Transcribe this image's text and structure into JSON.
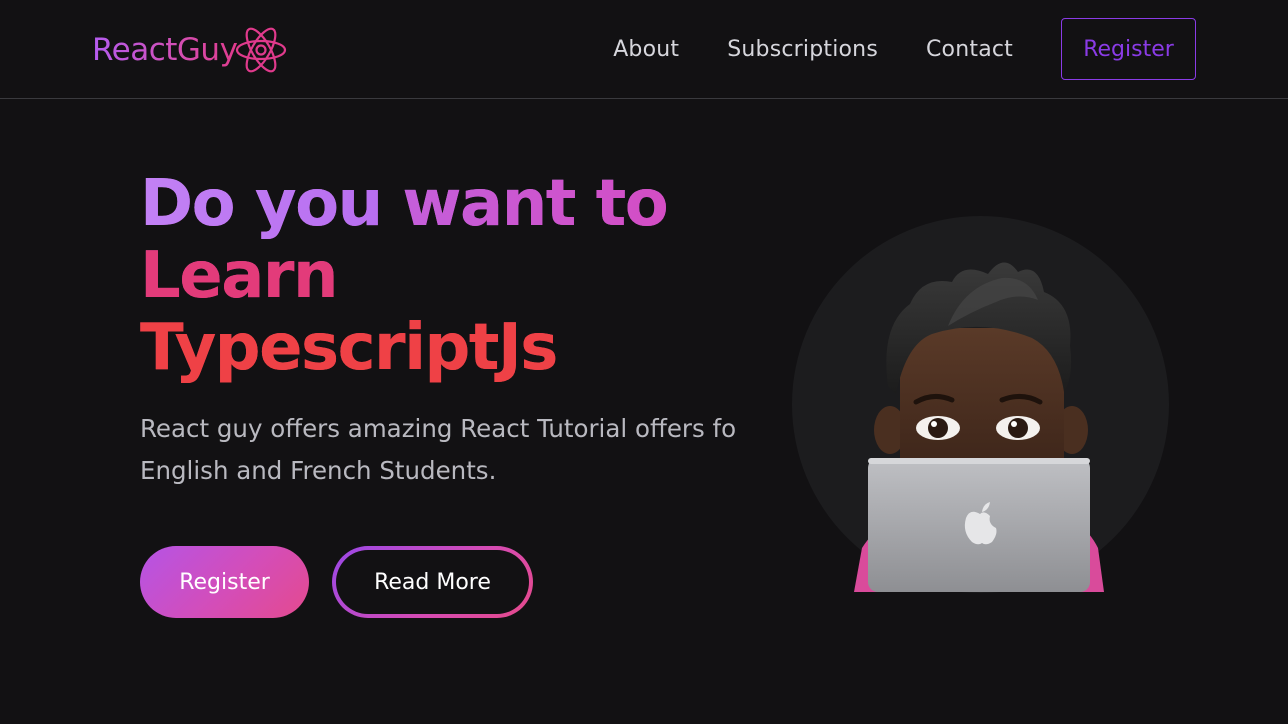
{
  "brand": {
    "name": "ReactGuy",
    "icon": "react-atom-icon",
    "colors": {
      "accent_purple": "#8a3be6",
      "gradient_start": "#b45cf0",
      "gradient_mid": "#d44fb4",
      "gradient_end": "#ef4146"
    }
  },
  "nav": {
    "links": [
      "About",
      "Subscriptions",
      "Contact"
    ],
    "register_label": "Register"
  },
  "hero": {
    "title": {
      "line1_word1": "Do you",
      "line1_word2": "want to",
      "line2": "Learn",
      "line3": "TypescriptJs"
    },
    "description_line1": "React guy offers amazing React Tutorial offers fo",
    "description_line2": "English and French Students.",
    "primary_button": "Register",
    "secondary_button": "Read More",
    "illustration": "memoji-avatar-with-laptop"
  }
}
